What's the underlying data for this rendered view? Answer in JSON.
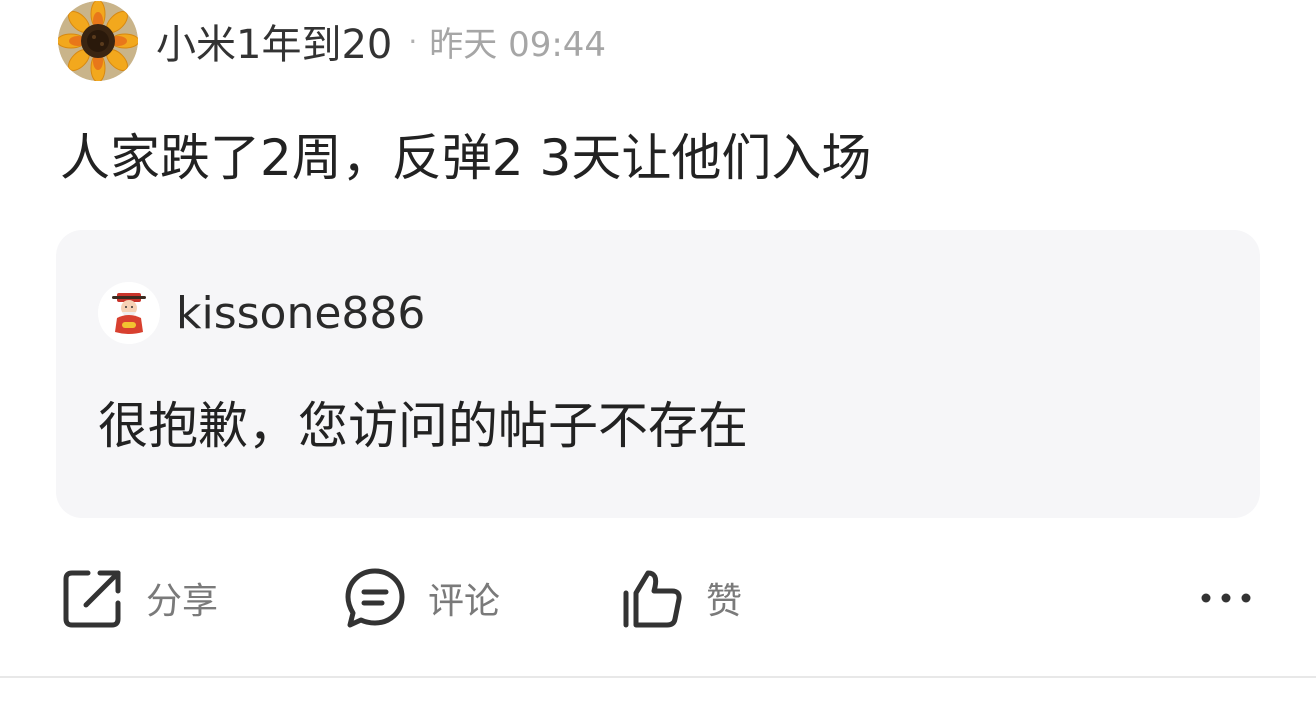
{
  "post": {
    "author": "小米1年到20",
    "separator": "·",
    "time": "昨天 09:44",
    "content": "人家跌了2周，反弹2 3天让他们入场"
  },
  "quote": {
    "author": "kissone886",
    "text": "很抱歉，您访问的帖子不存在"
  },
  "actions": {
    "share": {
      "label": "分享",
      "icon": "share-icon"
    },
    "comment": {
      "label": "评论",
      "icon": "comment-icon"
    },
    "like": {
      "label": "赞",
      "icon": "thumbs-up-icon"
    },
    "more": {
      "icon": "more-dots-icon"
    }
  },
  "colors": {
    "text_primary": "#222222",
    "text_secondary": "#7a7a7a",
    "timestamp": "#a6a6a6",
    "quote_background": "#f6f6f8",
    "icon": "#333333"
  }
}
